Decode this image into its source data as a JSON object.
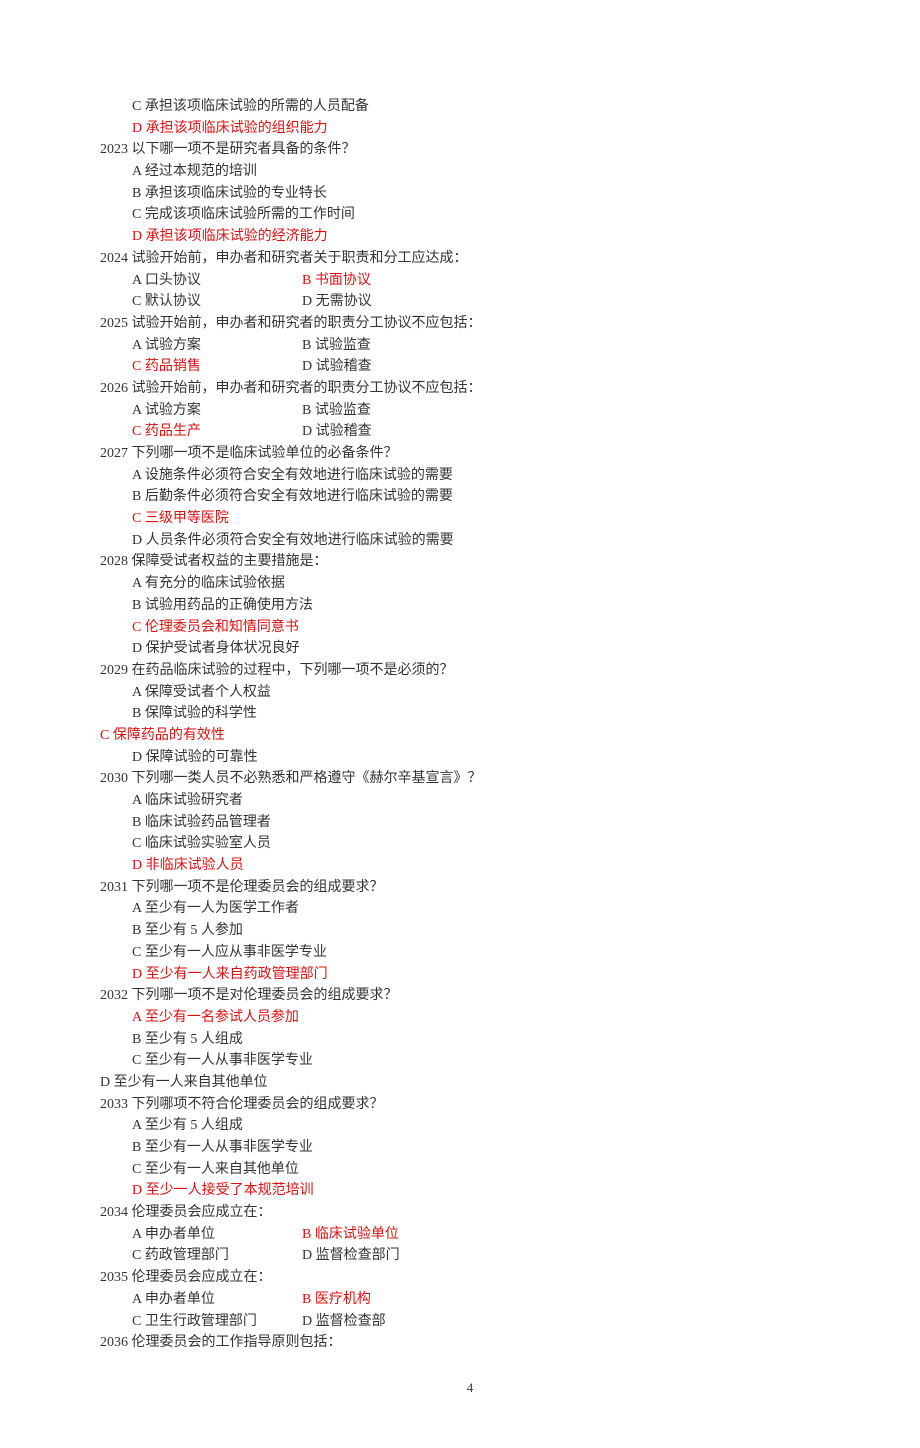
{
  "preOpts": [
    {
      "label": "C",
      "text": "承担该项临床试验的所需的人员配备",
      "ans": false
    },
    {
      "label": "D",
      "text": "承担该项临床试验的组织能力",
      "ans": true
    }
  ],
  "questions": [
    {
      "num": "2023",
      "text": "以下哪一项不是研究者具备的条件？",
      "layout": "single",
      "opts": [
        {
          "label": "A",
          "text": "经过本规范的培训",
          "ans": false
        },
        {
          "label": "B",
          "text": "承担该项临床试验的专业特长",
          "ans": false
        },
        {
          "label": "C",
          "text": "完成该项临床试验所需的工作时间",
          "ans": false
        },
        {
          "label": "D",
          "text": "承担该项临床试验的经济能力",
          "ans": true
        }
      ]
    },
    {
      "num": "2024",
      "text": "试验开始前，申办者和研究者关于职责和分工应达成：",
      "layout": "two",
      "rows": [
        [
          {
            "label": "A",
            "text": "口头协议",
            "ans": false
          },
          {
            "label": "B",
            "text": "书面协议",
            "ans": true
          }
        ],
        [
          {
            "label": "C",
            "text": "默认协议",
            "ans": false
          },
          {
            "label": "D",
            "text": "无需协议",
            "ans": false
          }
        ]
      ]
    },
    {
      "num": "2025",
      "text": "试验开始前，申办者和研究者的职责分工协议不应包括：",
      "layout": "two",
      "rows": [
        [
          {
            "label": "A",
            "text": "试验方案",
            "ans": false
          },
          {
            "label": "B",
            "text": "试验监查",
            "ans": false
          }
        ],
        [
          {
            "label": "C",
            "text": "药品销售",
            "ans": true
          },
          {
            "label": "D",
            "text": "试验稽查",
            "ans": false
          }
        ]
      ]
    },
    {
      "num": "2026",
      "text": "试验开始前，申办者和研究者的职责分工协议不应包括：",
      "layout": "two",
      "rows": [
        [
          {
            "label": "A",
            "text": "试验方案",
            "ans": false
          },
          {
            "label": "B",
            "text": "试验监查",
            "ans": false
          }
        ],
        [
          {
            "label": "C",
            "text": "药品生产",
            "ans": true
          },
          {
            "label": "D",
            "text": "试验稽查",
            "ans": false
          }
        ]
      ]
    },
    {
      "num": "2027",
      "text": "下列哪一项不是临床试验单位的必备条件？",
      "layout": "single",
      "opts": [
        {
          "label": "A",
          "text": "设施条件必须符合安全有效地进行临床试验的需要",
          "ans": false
        },
        {
          "label": "B",
          "text": "后勤条件必须符合安全有效地进行临床试验的需要",
          "ans": false
        },
        {
          "label": "C",
          "text": "三级甲等医院",
          "ans": true
        },
        {
          "label": "D",
          "text": "人员条件必须符合安全有效地进行临床试验的需要",
          "ans": false
        }
      ]
    },
    {
      "num": "2028",
      "text": "保障受试者权益的主要措施是：",
      "layout": "single",
      "opts": [
        {
          "label": "A",
          "text": "有充分的临床试验依据",
          "ans": false
        },
        {
          "label": "B",
          "text": "试验用药品的正确使用方法",
          "ans": false
        },
        {
          "label": "C",
          "text": "伦理委员会和知情同意书",
          "ans": true
        },
        {
          "label": "D",
          "text": "保护受试者身体状况良好",
          "ans": false
        }
      ]
    },
    {
      "num": "2029",
      "text": "在药品临床试验的过程中，下列哪一项不是必须的？",
      "layout": "single",
      "opts": [
        {
          "label": "A",
          "text": "保障受试者个人权益",
          "ans": false
        },
        {
          "label": "B",
          "text": "保障试验的科学性",
          "ans": false
        },
        {
          "label": "C",
          "text": "保障药品的有效性",
          "ans": true,
          "noindent": true
        },
        {
          "label": "D",
          "text": "保障试验的可靠性",
          "ans": false
        }
      ]
    },
    {
      "num": "2030",
      "text": "下列哪一类人员不必熟悉和严格遵守《赫尔辛基宣言》？",
      "layout": "single",
      "opts": [
        {
          "label": "A",
          "text": "临床试验研究者",
          "ans": false
        },
        {
          "label": "B",
          "text": "临床试验药品管理者",
          "ans": false
        },
        {
          "label": "C",
          "text": "临床试验实验室人员",
          "ans": false
        },
        {
          "label": "D",
          "text": "非临床试验人员",
          "ans": true
        }
      ]
    },
    {
      "num": "2031",
      "text": "下列哪一项不是伦理委员会的组成要求？",
      "layout": "single",
      "opts": [
        {
          "label": "A",
          "text": "至少有一人为医学工作者",
          "ans": false
        },
        {
          "label": "B",
          "text": "至少有 5 人参加",
          "ans": false
        },
        {
          "label": "C",
          "text": "至少有一人应从事非医学专业",
          "ans": false
        },
        {
          "label": "D",
          "text": "至少有一人来自药政管理部门",
          "ans": true
        }
      ]
    },
    {
      "num": "2032",
      "text": "下列哪一项不是对伦理委员会的组成要求？",
      "layout": "single",
      "opts": [
        {
          "label": "A",
          "text": "至少有一名参试人员参加",
          "ans": true
        },
        {
          "label": "B",
          "text": "至少有 5 人组成",
          "ans": false
        },
        {
          "label": "C",
          "text": "至少有一人从事非医学专业",
          "ans": false
        },
        {
          "label": "D",
          "text": "至少有一人来自其他单位",
          "ans": false,
          "noindent": true
        }
      ]
    },
    {
      "num": "2033",
      "text": "下列哪项不符合伦理委员会的组成要求？",
      "layout": "single",
      "opts": [
        {
          "label": "A",
          "text": "至少有 5 人组成",
          "ans": false
        },
        {
          "label": "B",
          "text": "至少有一人从事非医学专业",
          "ans": false
        },
        {
          "label": "C",
          "text": "至少有一人来自其他单位",
          "ans": false
        },
        {
          "label": "D",
          "text": "至少一人接受了本规范培训",
          "ans": true
        }
      ]
    },
    {
      "num": "2034",
      "text": "伦理委员会应成立在：",
      "layout": "two",
      "rows": [
        [
          {
            "label": "A",
            "text": "申办者单位",
            "ans": false
          },
          {
            "label": "B",
            "text": "临床试验单位",
            "ans": true
          }
        ],
        [
          {
            "label": "C",
            "text": "药政管理部门",
            "ans": false
          },
          {
            "label": "D",
            "text": "监督检查部门",
            "ans": false
          }
        ]
      ]
    },
    {
      "num": "2035",
      "text": "伦理委员会应成立在：",
      "layout": "two",
      "rows": [
        [
          {
            "label": "A",
            "text": "申办者单位",
            "ans": false
          },
          {
            "label": "B",
            "text": "医疗机构",
            "ans": true
          }
        ],
        [
          {
            "label": "C",
            "text": "卫生行政管理部门",
            "ans": false
          },
          {
            "label": "D",
            "text": "监督检查部",
            "ans": false
          }
        ]
      ]
    },
    {
      "num": "2036",
      "text": "伦理委员会的工作指导原则包括：",
      "layout": "none"
    }
  ],
  "pageNumber": "4"
}
